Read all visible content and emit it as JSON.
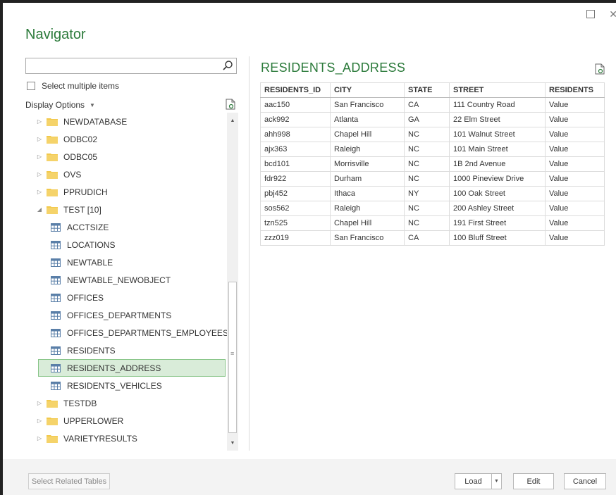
{
  "window": {
    "title": "Navigator",
    "maximize_icon": "maximize-icon",
    "close_icon": "close-icon"
  },
  "search": {
    "value": "",
    "placeholder": "",
    "icon": "search-icon"
  },
  "select_multiple": {
    "label": "Select multiple items",
    "checked": false
  },
  "display_options": {
    "label": "Display Options",
    "refresh_icon": "refresh-icon"
  },
  "tree": {
    "nodes": [
      {
        "label": "NEWDATABASE",
        "type": "folder",
        "expanded": false
      },
      {
        "label": "ODBC02",
        "type": "folder",
        "expanded": false
      },
      {
        "label": "ODBC05",
        "type": "folder",
        "expanded": false
      },
      {
        "label": "OVS",
        "type": "folder",
        "expanded": false
      },
      {
        "label": "PPRUDICH",
        "type": "folder",
        "expanded": false
      },
      {
        "label": "TEST [10]",
        "type": "folder",
        "expanded": true
      },
      {
        "label": "ACCTSIZE",
        "type": "table"
      },
      {
        "label": "LOCATIONS",
        "type": "table"
      },
      {
        "label": "NEWTABLE",
        "type": "table"
      },
      {
        "label": "NEWTABLE_NEWOBJECT",
        "type": "table"
      },
      {
        "label": "OFFICES",
        "type": "table"
      },
      {
        "label": "OFFICES_DEPARTMENTS",
        "type": "table"
      },
      {
        "label": "OFFICES_DEPARTMENTS_EMPLOYEES",
        "type": "table"
      },
      {
        "label": "RESIDENTS",
        "type": "table"
      },
      {
        "label": "RESIDENTS_ADDRESS",
        "type": "table",
        "selected": true
      },
      {
        "label": "RESIDENTS_VEHICLES",
        "type": "table"
      },
      {
        "label": "TESTDB",
        "type": "folder",
        "expanded": false
      },
      {
        "label": "UPPERLOWER",
        "type": "folder",
        "expanded": false
      },
      {
        "label": "VARIETYRESULTS",
        "type": "folder",
        "expanded": false
      }
    ]
  },
  "preview": {
    "title": "RESIDENTS_ADDRESS",
    "columns": [
      "RESIDENTS_ID",
      "CITY",
      "STATE",
      "STREET",
      "RESIDENTS"
    ],
    "rows": [
      [
        "aac150",
        "San Francisco",
        "CA",
        "111 Country Road",
        "Value"
      ],
      [
        "ack992",
        "Atlanta",
        "GA",
        "22 Elm Street",
        "Value"
      ],
      [
        "ahh998",
        "Chapel Hill",
        "NC",
        "101 Walnut Street",
        "Value"
      ],
      [
        "ajx363",
        "Raleigh",
        "NC",
        "101 Main Street",
        "Value"
      ],
      [
        "bcd101",
        "Morrisville",
        "NC",
        "1B 2nd Avenue",
        "Value"
      ],
      [
        "fdr922",
        "Durham",
        "NC",
        "1000 Pineview Drive",
        "Value"
      ],
      [
        "pbj452",
        "Ithaca",
        "NY",
        "100 Oak Street",
        "Value"
      ],
      [
        "sos562",
        "Raleigh",
        "NC",
        "200 Ashley Street",
        "Value"
      ],
      [
        "tzn525",
        "Chapel Hill",
        "NC",
        "191 First Street",
        "Value"
      ],
      [
        "zzz019",
        "San Francisco",
        "CA",
        "100 Bluff Street",
        "Value"
      ]
    ]
  },
  "footer": {
    "select_related": "Select Related Tables",
    "load": "Load",
    "edit": "Edit",
    "cancel": "Cancel"
  },
  "colors": {
    "accent": "#2b7a3a",
    "selection_bg": "#d9ecd9",
    "folder": "#f2c94c"
  }
}
